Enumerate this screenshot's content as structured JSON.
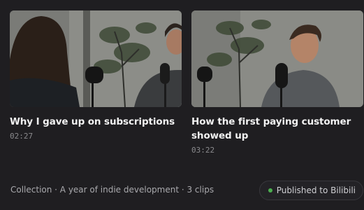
{
  "clips": [
    {
      "title": "Why I gave up on subscriptions",
      "duration": "02:27"
    },
    {
      "title": "How the first paying customer showed up",
      "duration": "03:22"
    }
  ],
  "footer": {
    "collection_text": "Collection · A year of indie development · 3 clips",
    "publish_status": "Published to Bilibili",
    "status_color": "#4caf50"
  },
  "icons": {
    "status": "status-dot-icon"
  }
}
